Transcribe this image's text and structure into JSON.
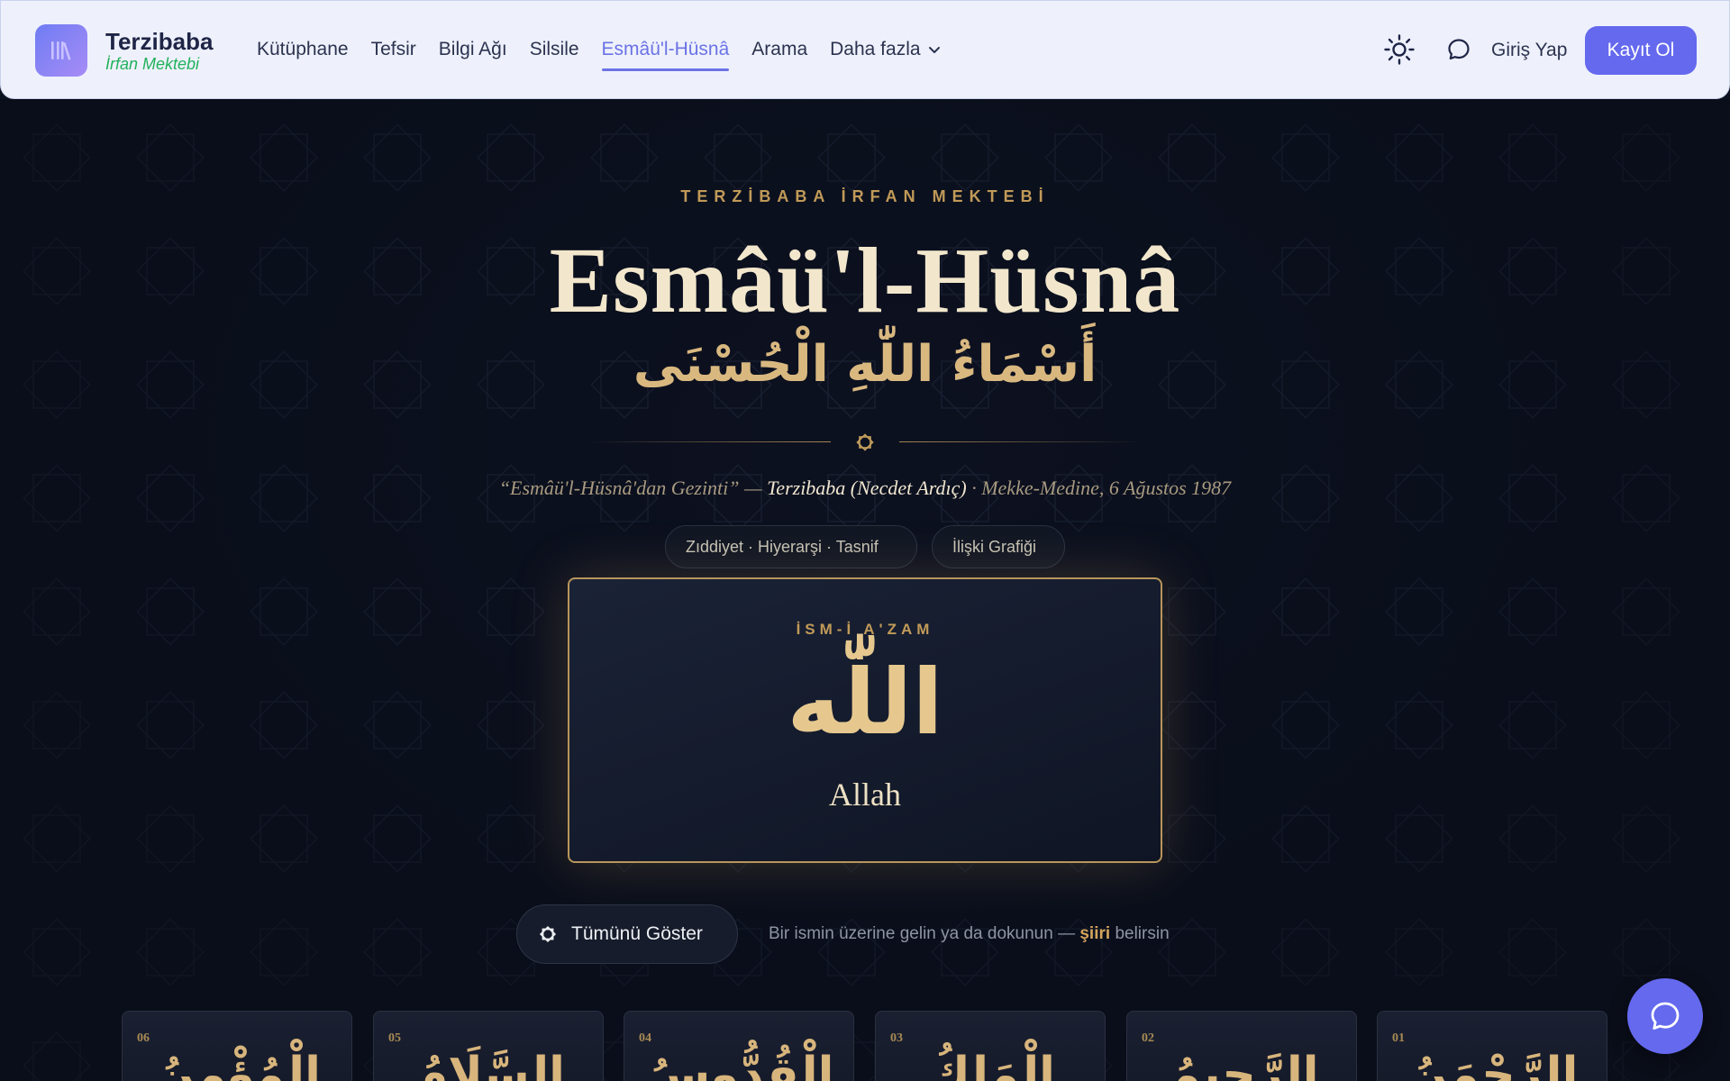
{
  "brand": {
    "title": "Terzibaba",
    "subtitle": "İrfan Mektebi",
    "icon": "books-icon"
  },
  "nav": {
    "items": [
      {
        "label": "Kütüphane",
        "active": false
      },
      {
        "label": "Tefsir",
        "active": false
      },
      {
        "label": "Bilgi Ağı",
        "active": false
      },
      {
        "label": "Silsile",
        "active": false
      },
      {
        "label": "Esmâü'l-Hüsnâ",
        "active": true
      },
      {
        "label": "Arama",
        "active": false
      },
      {
        "label": "Daha fazla",
        "active": false
      }
    ],
    "login_label": "Giriş Yap",
    "signup_label": "Kayıt Ol"
  },
  "hero": {
    "eyebrow": "TERZİBABA İRFAN MEKTEBİ",
    "title": "Esmâü'l-Hüsnâ",
    "arabic": "أَسْمَاءُ اللّٰهِ الْحُسْنَى",
    "citation_quote": "“Esmâü'l-Hüsnâ'dan Gezinti” —",
    "citation_author": "Terzibaba (Necdet Ardıç)",
    "citation_place": "· Mekke-Medine, 6 Ağustos 1987"
  },
  "chips": {
    "hierarchy": "Zıddiyet · Hiyerarşi · Tasnif",
    "graph": "İlişki Grafiği"
  },
  "azam": {
    "label": "İSM-İ A'ZAM",
    "arabic": "اللّٰه",
    "latin": "Allah"
  },
  "controls": {
    "show_all_label": "Tümünü Göster",
    "hint_before": "Bir ismin üzerine gelin ya da dokunun —",
    "hint_strong": "şiiri",
    "hint_after": "belirsin"
  },
  "names": [
    {
      "num": "06",
      "arabic": "الْمُؤْمِنُ"
    },
    {
      "num": "05",
      "arabic": "السَّلَامُ"
    },
    {
      "num": "04",
      "arabic": "الْقُدُّوسُ"
    },
    {
      "num": "03",
      "arabic": "الْمَلِكُ"
    },
    {
      "num": "02",
      "arabic": "الرَّحِيمُ"
    },
    {
      "num": "01",
      "arabic": "الرَّحْمَنُ"
    }
  ],
  "colors": {
    "accent": "#6469ee",
    "gold": "#c19a58",
    "background": "#0d1220",
    "header_bg": "#eef1fb"
  }
}
